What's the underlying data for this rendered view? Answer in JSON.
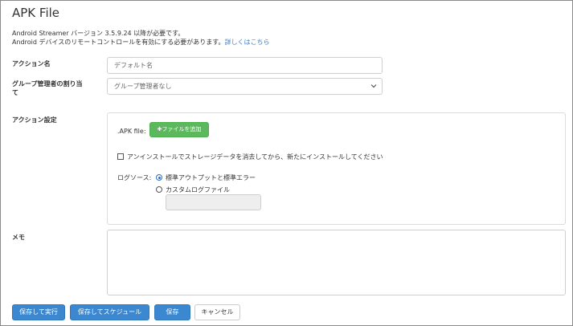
{
  "page": {
    "title": "APK File",
    "description_line1": "Android Streamer バージョン 3.5.9.24 以降が必要です。",
    "description_line2": "Android デバイスのリモートコントロールを有効にする必要があります。",
    "learn_more_link": "詳しくはこちら"
  },
  "form": {
    "action_name_label": "アクション名",
    "action_name_value": "デフォルト名",
    "group_admin_label_line1": "グループ管理者の割り当",
    "group_admin_label_line2": "て",
    "group_admin_value": "グループ管理者なし",
    "action_settings_label": "アクション設定",
    "memo_label": "メモ",
    "memo_value": ""
  },
  "settings": {
    "apk_file_label": ".APK file:",
    "add_file_button": "✚ファイルを追加",
    "reinstall_checkbox_label": "アンインストールでストレージデータを消去してから、新たにインストールしてください",
    "reinstall_checked": false,
    "log_source_label": "ログソース:",
    "log_options": [
      {
        "label": "標準アウトプットと標準エラー",
        "selected": true
      },
      {
        "label": "カスタムログファイル",
        "selected": false
      }
    ],
    "custom_log_value": ""
  },
  "buttons": {
    "save_and_run": "保存して実行",
    "save_and_schedule": "保存してスケジュール",
    "save": "保存",
    "cancel": "キャンセル"
  },
  "colors": {
    "primary": "#3b87d0",
    "success": "#5cb85c",
    "link": "#3a7fc4"
  }
}
